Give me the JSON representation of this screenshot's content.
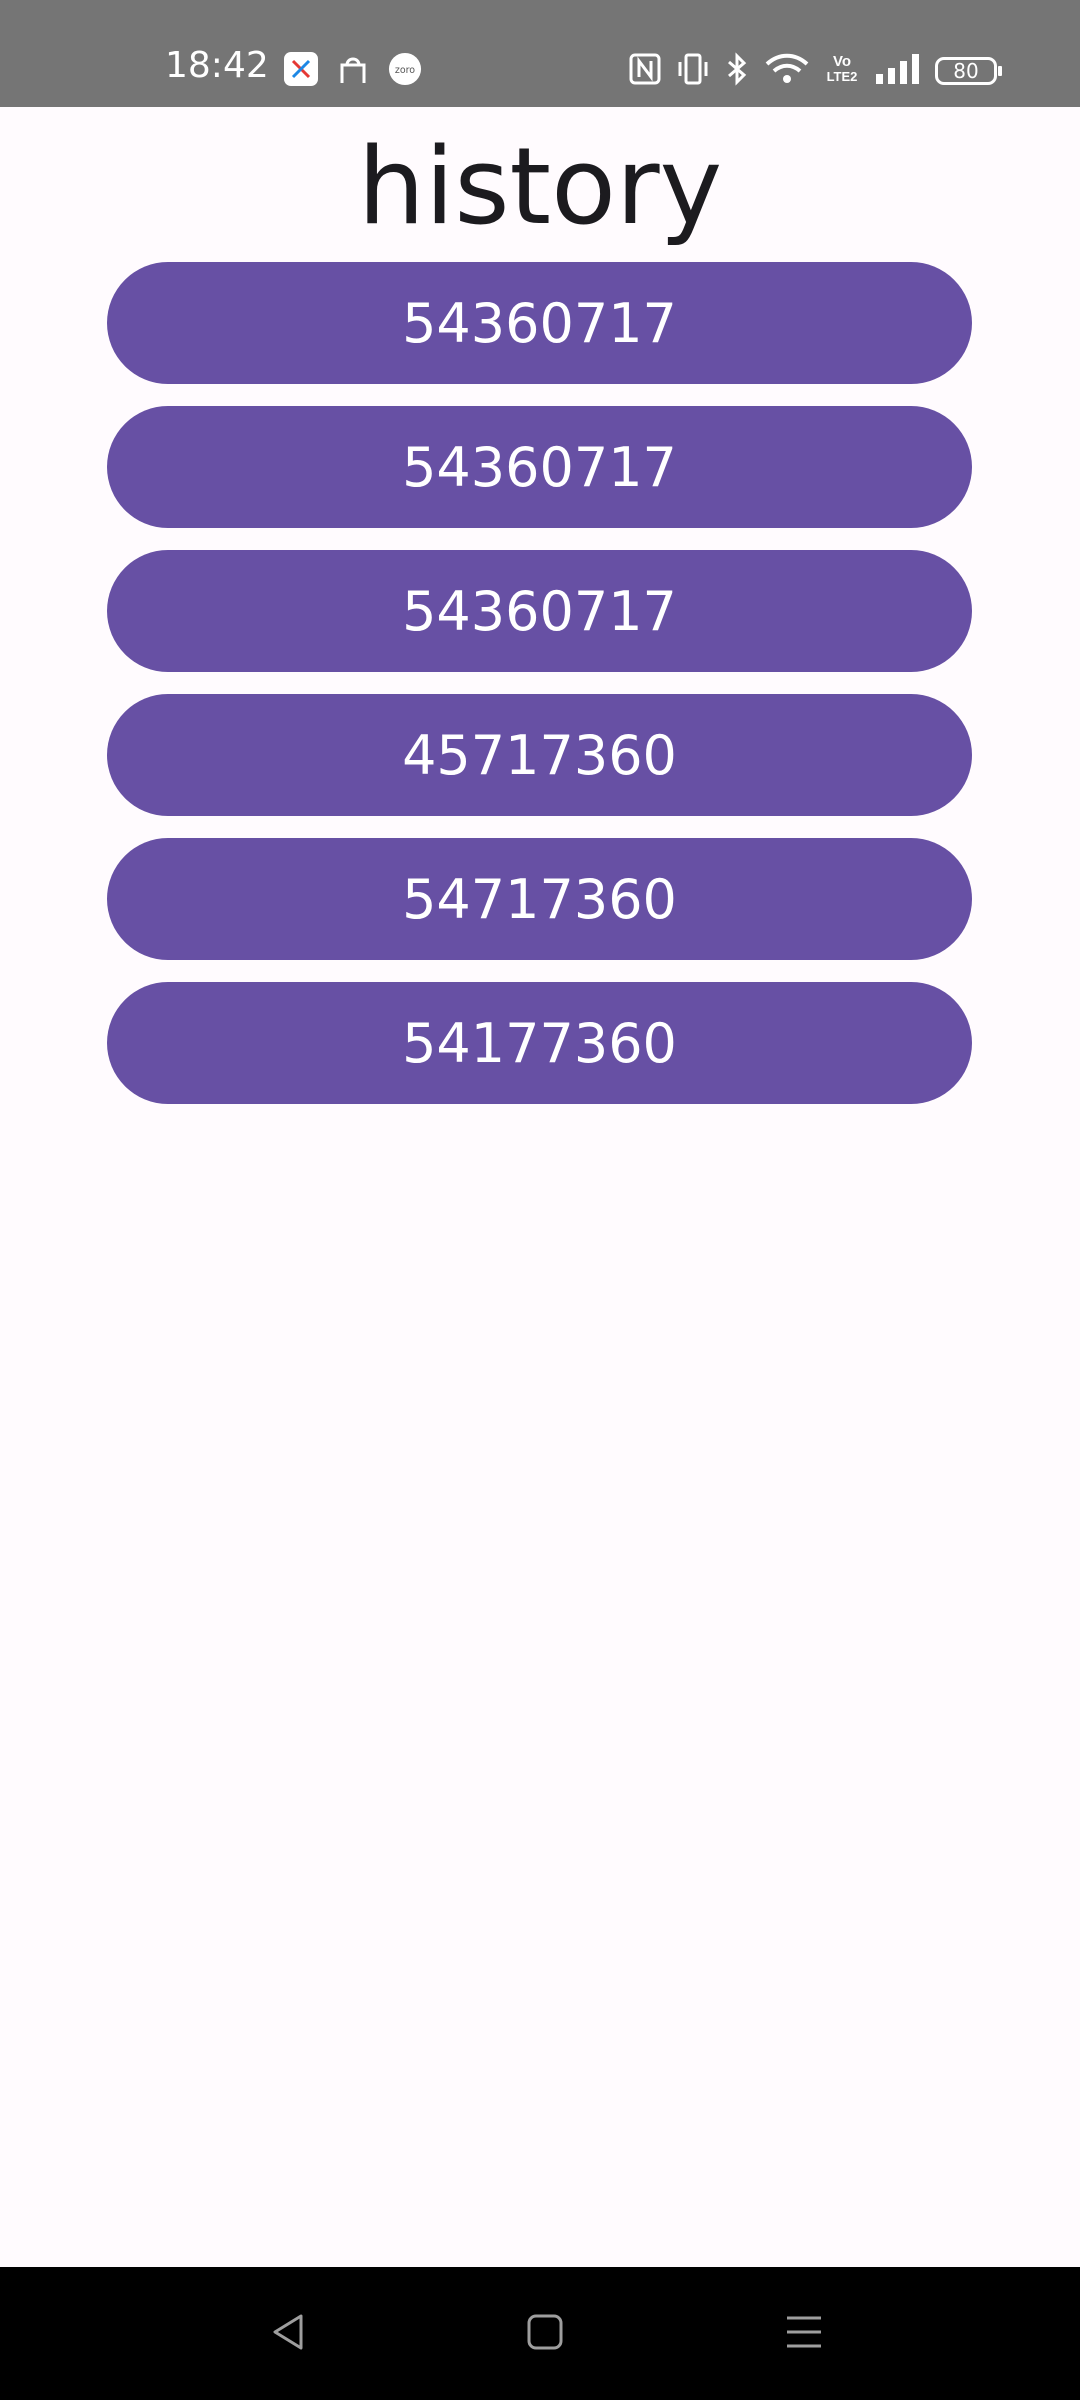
{
  "status_bar": {
    "time": "18:42",
    "notification_icons": [
      "tasks-icon",
      "shopping-bag-icon",
      "zoro-icon"
    ],
    "zoro_label": "zoro",
    "system_icons": [
      "nfc-icon",
      "vibrate-icon",
      "bluetooth-icon",
      "wifi-icon",
      "volte-icon",
      "signal-icon"
    ],
    "volte_label_top": "Vo",
    "volte_label_bottom": "LTE2",
    "battery_level": "80"
  },
  "page": {
    "title": "history"
  },
  "history": {
    "items": [
      "54360717",
      "54360717",
      "54360717",
      "45717360",
      "54717360",
      "54177360"
    ]
  },
  "colors": {
    "status_bar_bg": "#757575",
    "background": "#fffbfe",
    "button": "#6750a4",
    "button_text": "#ffffff",
    "nav_bar_bg": "#000000"
  },
  "nav_bar": {
    "buttons": [
      "back-icon",
      "home-icon",
      "recents-icon"
    ]
  }
}
